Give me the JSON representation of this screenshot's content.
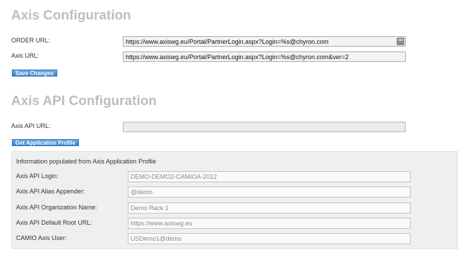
{
  "axis_config": {
    "title": "Axis Configuration",
    "order_url_label": "ORDER URL:",
    "order_url_value": "https://www.axiswg.eu/Portal/PartnerLogin.aspx?Login=%s@chyron.com",
    "axis_url_label": "Axis URL:",
    "axis_url_value": "https://www.axiswg.eu/Portal/PartnerLogin.aspx?Login=%s@chyron.com&ver=2",
    "save_button": "Save Changes"
  },
  "api_config": {
    "title": "Axis API Configuration",
    "api_url_label": "Axis API URL:",
    "api_url_value": "",
    "get_profile_button": "Get Application Profile",
    "info_text": "Information populated from Axis Application Profile",
    "fields": [
      {
        "label": "Axis API Login:",
        "value": "DEMO-DEMO2-CAMIOA-2012"
      },
      {
        "label": "Axis API Alias Appender:",
        "value": "@demo"
      },
      {
        "label": "Axis API Organization Name:",
        "value": "Demo Rack 1"
      },
      {
        "label": "Axis API Default Root URL:",
        "value": "https://www.axiswg.eu"
      },
      {
        "label": "CAMIO Axis User:",
        "value": "USDemo1@demo"
      }
    ]
  },
  "icons": {
    "order_field_icon": "keyboard-icon"
  }
}
